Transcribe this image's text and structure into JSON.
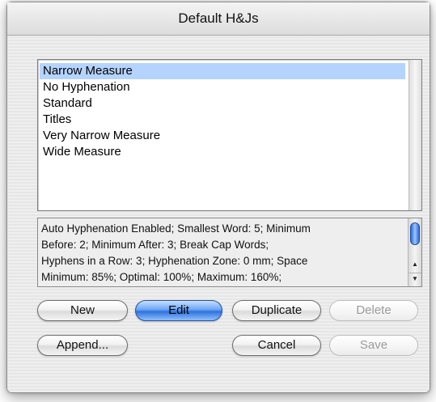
{
  "window": {
    "title": "Default H&Js"
  },
  "list": {
    "items": [
      "Narrow Measure",
      "No Hyphenation",
      "Standard",
      "Titles",
      "Very Narrow Measure",
      "Wide Measure"
    ],
    "selected_index": 0
  },
  "info": {
    "lines": [
      "Auto Hyphenation Enabled;  Smallest Word: 5;  Minimum",
      "Before: 2;  Minimum After: 3;  Break Cap Words;",
      "Hyphens in a Row: 3;  Hyphenation Zone: 0 mm;  Space",
      "Minimum: 85%;  Optimal: 100%;  Maximum: 160%;"
    ]
  },
  "buttons": {
    "new": "New",
    "edit": "Edit",
    "duplicate": "Duplicate",
    "delete": "Delete",
    "append": "Append...",
    "cancel": "Cancel",
    "save": "Save"
  },
  "icons": {
    "scroll_up": "up-arrow-icon",
    "scroll_down": "down-arrow-icon"
  },
  "colors": {
    "selection": "#b5d3ff",
    "default_button": "#2f72dc",
    "scroll_thumb": "#2c6bd8"
  }
}
